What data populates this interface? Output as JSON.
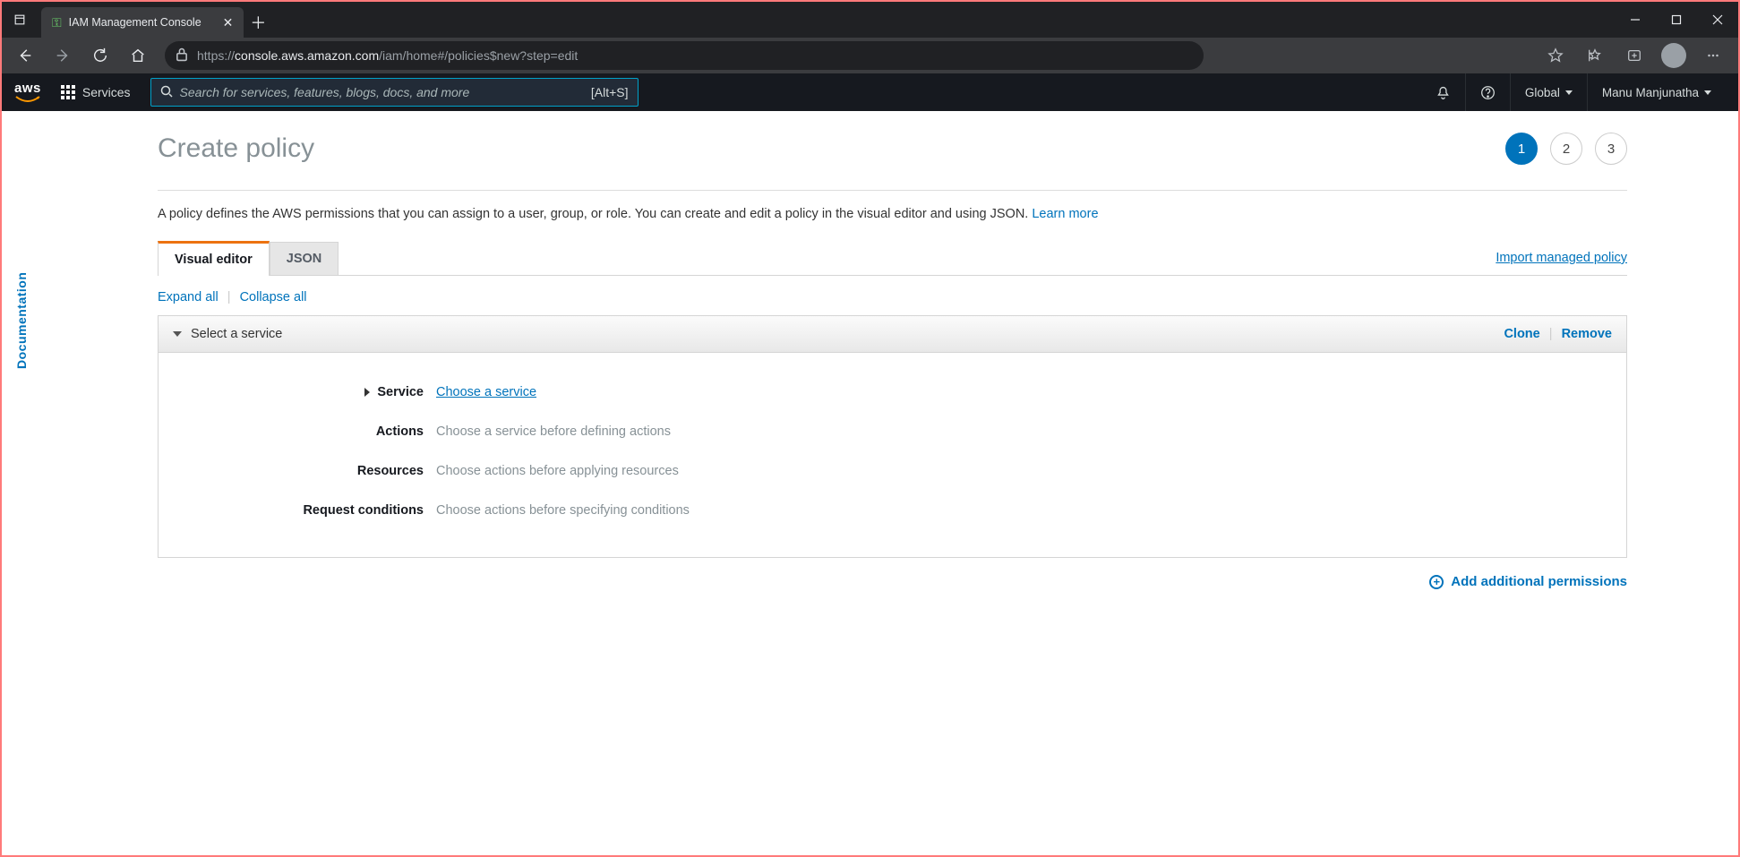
{
  "browser": {
    "tab_title": "IAM Management Console",
    "url_prefix": "https://",
    "url_host": "console.aws.amazon.com",
    "url_path": "/iam/home#/policies$new?step=edit"
  },
  "aws_nav": {
    "services_label": "Services",
    "search_placeholder": "Search for services, features, blogs, docs, and more",
    "search_shortcut": "[Alt+S]",
    "region": "Global",
    "user": "Manu Manjunatha"
  },
  "side_tab": "Documentation",
  "page": {
    "title": "Create policy",
    "steps": [
      "1",
      "2",
      "3"
    ],
    "active_step": 0,
    "description": "A policy defines the AWS permissions that you can assign to a user, group, or role. You can create and edit a policy in the visual editor and using JSON. ",
    "learn_more": "Learn more",
    "tabs": {
      "visual": "Visual editor",
      "json": "JSON"
    },
    "import_link": "Import managed policy",
    "expand_all": "Expand all",
    "collapse_all": "Collapse all",
    "section": {
      "title": "Select a service",
      "clone": "Clone",
      "remove": "Remove",
      "rows": {
        "service_label": "Service",
        "service_value": "Choose a service",
        "actions_label": "Actions",
        "actions_value": "Choose a service before defining actions",
        "resources_label": "Resources",
        "resources_value": "Choose actions before applying resources",
        "conditions_label": "Request conditions",
        "conditions_value": "Choose actions before specifying conditions"
      }
    },
    "add_permissions": "Add additional permissions"
  }
}
